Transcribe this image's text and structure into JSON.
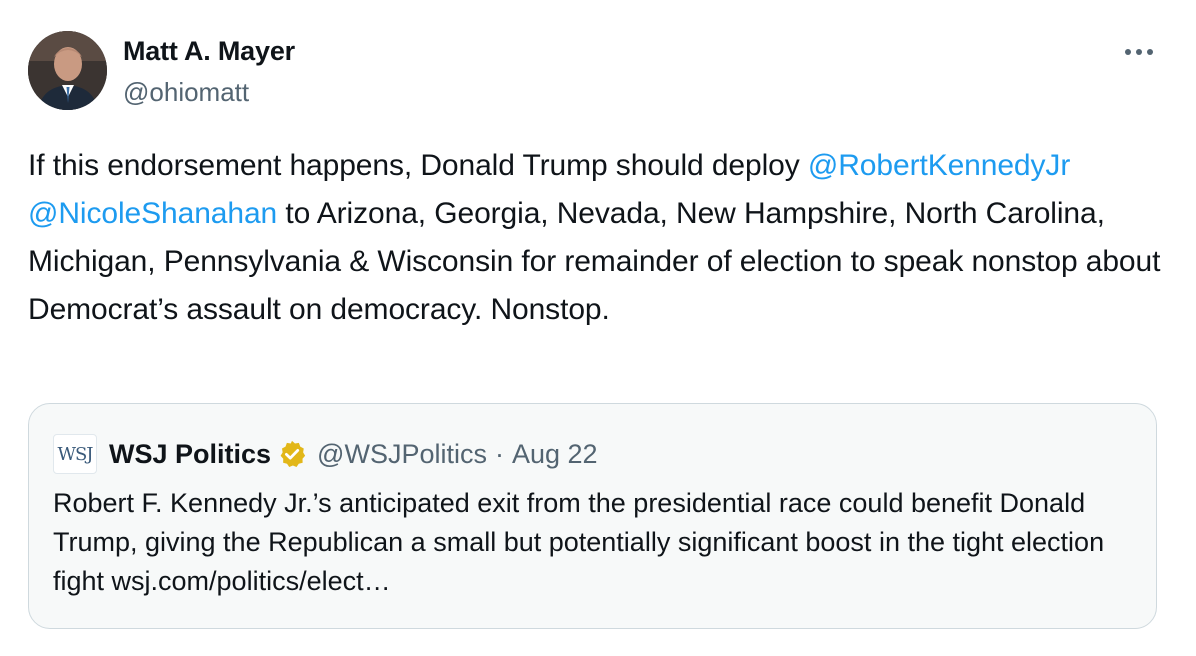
{
  "author": {
    "display_name": "Matt A. Mayer",
    "handle": "@ohiomatt"
  },
  "menu": {
    "more_icon": "more-horizontal-icon"
  },
  "tweet": {
    "text_part1": "If this endorsement happens, Donald Trump should deploy ",
    "mention1": "@RobertKennedyJr",
    "space": " ",
    "mention2": "@NicoleShanahan",
    "text_part2": " to Arizona, Georgia, Nevada, New Hampshire, North Carolina, Michigan, Pennsylvania & Wisconsin for remainder of election to speak nonstop about Democrat’s assault on democracy. Nonstop."
  },
  "quote": {
    "logo_text": "WSJ",
    "name": "WSJ Politics",
    "verified_icon": "verified-badge-gold-icon",
    "handle": "@WSJPolitics",
    "separator": "·",
    "date": "Aug 22",
    "text": "Robert F. Kennedy Jr.’s anticipated exit from the presidential race could benefit Donald Trump, giving the Republican a small but potentially significant boost in the tight election fight wsj.com/politics/elect…"
  },
  "colors": {
    "link": "#1d9bf0",
    "secondary_text": "#536471",
    "border": "#cfd9de",
    "verified_gold": "#e2b719"
  }
}
